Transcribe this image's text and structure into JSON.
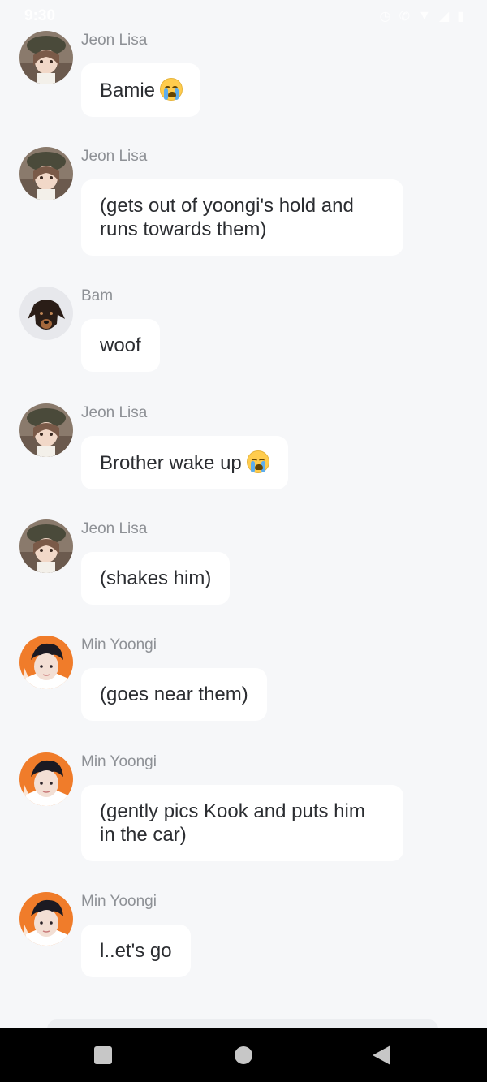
{
  "status_bar": {
    "time": "9:30",
    "icons": [
      "alarm-icon",
      "call-icon",
      "wifi-icon",
      "signal-icon",
      "battery-icon"
    ]
  },
  "messages": [
    {
      "sender": "Jeon Lisa",
      "text": "Bamie",
      "emoji": "crying-face",
      "avatar": "lisa-avatar"
    },
    {
      "sender": "Jeon Lisa",
      "text_lines": [
        "(gets out of yoongi's hold and",
        "runs towards them)"
      ],
      "avatar": "lisa-avatar"
    },
    {
      "sender": "Bam",
      "text": "woof",
      "avatar": "dog-avatar"
    },
    {
      "sender": "Jeon Lisa",
      "text": "Brother wake up",
      "emoji": "crying-face",
      "avatar": "lisa-avatar"
    },
    {
      "sender": "Jeon Lisa",
      "text": "(shakes him)",
      "avatar": "lisa-avatar"
    },
    {
      "sender": "Min Yoongi",
      "text": "(goes near them)",
      "avatar": "yoongi-avatar"
    },
    {
      "sender": "Min Yoongi",
      "text_lines": [
        "(gently pics Kook and puts him",
        "in the car)"
      ],
      "avatar": "yoongi-avatar"
    },
    {
      "sender": "Min Yoongi",
      "text": "l..et's go",
      "avatar": "yoongi-avatar"
    }
  ],
  "nav": {
    "recent": "recent-apps-icon",
    "home": "home-icon",
    "back": "back-icon"
  }
}
